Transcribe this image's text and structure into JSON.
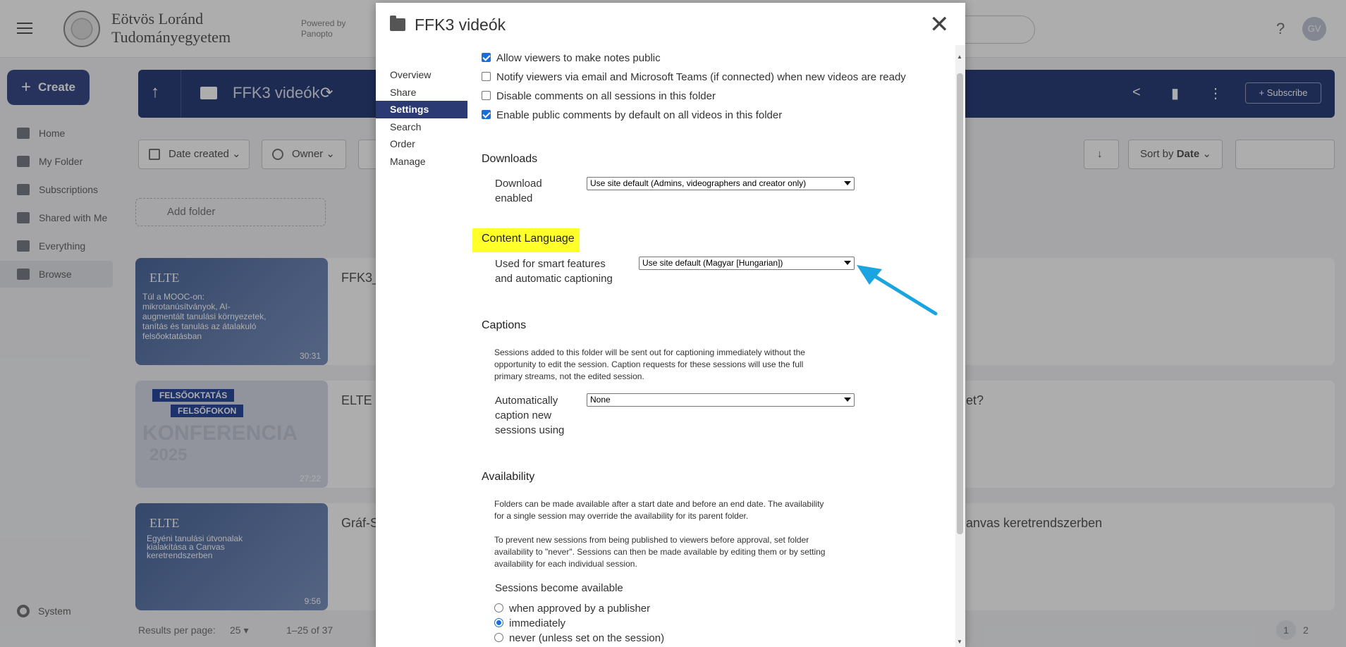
{
  "app": {
    "org_line1": "Eötvös Loránd",
    "org_line2": "Tudományegyetem",
    "powered_line1": "Powered by",
    "powered_line2": "Panopto",
    "help_glyph": "?",
    "avatar_initials": "GV"
  },
  "sidebar": {
    "create_label": "Create",
    "items": [
      {
        "label": "Home",
        "icon": "home-icon"
      },
      {
        "label": "My Folder",
        "icon": "star-folder-icon"
      },
      {
        "label": "Subscriptions",
        "icon": "subscriptions-icon"
      },
      {
        "label": "Shared with Me",
        "icon": "share-icon"
      },
      {
        "label": "Everything",
        "icon": "play-stack-icon"
      },
      {
        "label": "Browse",
        "icon": "folder-icon"
      }
    ],
    "system_label": "System"
  },
  "folder_bar": {
    "title": "FFK3 videók",
    "subscribe_label": "Subscribe"
  },
  "filters": {
    "date_created": "Date created",
    "owner": "Owner",
    "sort_by_prefix": "Sort by",
    "sort_by_value": "Date",
    "add_folder": "Add folder"
  },
  "tiles": [
    {
      "duration": "30:31",
      "title": "FFK3_",
      "thumb_line1": "ELTE",
      "thumb_text": "Túl a MOOC-on: mikrotanúsítványok, AI-augmentált tanulási környezetek, tanítás és tanulás az átalakuló felsőoktatásban"
    },
    {
      "duration": "27:22",
      "title": "ELTE I",
      "right_text": "et?",
      "thumb_line1": "FELSŐOKTATÁS",
      "thumb_line2": "FELSŐFOKON",
      "thumb_big": "KONFERENCIA",
      "thumb_year": "2025"
    },
    {
      "duration": "9:56",
      "title": "Gráf-S",
      "right_text": "anvas keretrendszerben",
      "thumb_line1": "ELTE",
      "thumb_text": "Egyéni tanulási útvonalak kialakítása a Canvas keretrendszerben"
    }
  ],
  "pager": {
    "results_label": "Results per page:",
    "per_page": "25",
    "range": "1–25 of 37",
    "page1": "1",
    "page2": "2"
  },
  "dialog": {
    "title": "FFK3 videók",
    "close_glyph": "✕",
    "nav": [
      "Overview",
      "Share",
      "Settings",
      "Search",
      "Order",
      "Manage"
    ],
    "nav_selected": "Settings",
    "checkboxes": [
      {
        "label": "Allow viewers to make notes public",
        "checked": true
      },
      {
        "label": "Notify viewers via email and Microsoft Teams (if connected) when new videos are ready",
        "checked": false
      },
      {
        "label": "Disable comments on all sessions in this folder",
        "checked": false
      },
      {
        "label": "Enable public comments by default on all videos in this folder",
        "checked": true
      }
    ],
    "downloads": {
      "heading": "Downloads",
      "label_line1": "Download",
      "label_line2": "enabled",
      "value": "Use site default (Admins, videographers and creator only)"
    },
    "content_language": {
      "heading": "Content Language",
      "label_line1": "Used for smart features",
      "label_line2": "and automatic captioning",
      "value": "Use site default (Magyar [Hungarian])",
      "highlight_color": "#ffff2a",
      "arrow_color": "#1aa5e0"
    },
    "captions": {
      "heading": "Captions",
      "note_line1": "Sessions added to this folder will be sent out for captioning immediately without the",
      "note_line2": "opportunity to edit the session. Caption requests for these sessions will use the full",
      "note_line3": "primary streams, not the edited session.",
      "label_line1": "Automatically",
      "label_line2": "caption new",
      "label_line3": "sessions using",
      "value": "None"
    },
    "availability": {
      "heading": "Availability",
      "p1_line1": "Folders can be made available after a start date and before an end date. The availability",
      "p1_line2": "for a single session may override the availability for its parent folder.",
      "p2_line1": "To prevent new sessions from being published to viewers before approval, set folder",
      "p2_line2": "availability to \"never\". Sessions can then be made available by editing them or by setting",
      "p2_line3": "availability for each individual session.",
      "sub_heading": "Sessions become available",
      "options": [
        {
          "label": "when approved by a publisher",
          "selected": false
        },
        {
          "label": "immediately",
          "selected": true
        },
        {
          "label": "never (unless set on the session)",
          "selected": false
        }
      ]
    }
  }
}
